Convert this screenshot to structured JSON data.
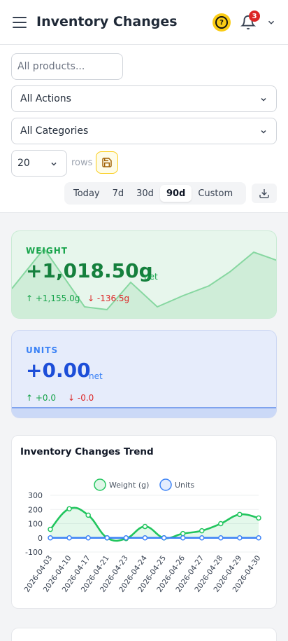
{
  "header": {
    "title": "Inventory Changes",
    "help_icon": "question-circle-icon",
    "help_glyph": "?",
    "notifications_count": "3",
    "accent": "#facc15"
  },
  "filters": {
    "search_placeholder": "All products...",
    "action_select": "All Actions",
    "category_select": "All Categories",
    "rows_value": "20",
    "rows_label": "rows",
    "ranges": [
      "Today",
      "7d",
      "30d",
      "90d",
      "Custom"
    ],
    "active_range": "90d"
  },
  "weight_card": {
    "label": "WEIGHT",
    "value": "+1,018.50g",
    "net_label": "net",
    "up": "↑ +1,155.0g",
    "down": "↓ -136.5g",
    "color": "#15803d"
  },
  "units_card": {
    "label": "UNITS",
    "value": "+0.00",
    "net_label": "net",
    "up": "↑ +0.0",
    "down": "↓ -0.0",
    "color": "#1d4ed8"
  },
  "chart": {
    "title": "Inventory Changes Trend"
  },
  "chart_data": {
    "type": "line",
    "x": [
      "2026-04-03",
      "2026-04-10",
      "2026-04-17",
      "2026-04-21",
      "2026-04-23",
      "2026-04-24",
      "2026-04-25",
      "2026-04-26",
      "2026-04-27",
      "2026-04-28",
      "2026-04-29",
      "2026-04-30"
    ],
    "series": [
      {
        "name": "Weight (g)",
        "color": "#22c55e",
        "values": [
          60,
          205,
          160,
          0,
          -5,
          80,
          0,
          30,
          50,
          100,
          165,
          140
        ]
      },
      {
        "name": "Units",
        "color": "#3b82f6",
        "values": [
          0,
          0,
          0,
          0,
          0,
          0,
          0,
          0,
          0,
          0,
          0,
          0
        ]
      }
    ],
    "ylim": [
      -100,
      300
    ],
    "yticks": [
      "300",
      "200",
      "100",
      "0",
      "-100"
    ],
    "legend": "top"
  }
}
